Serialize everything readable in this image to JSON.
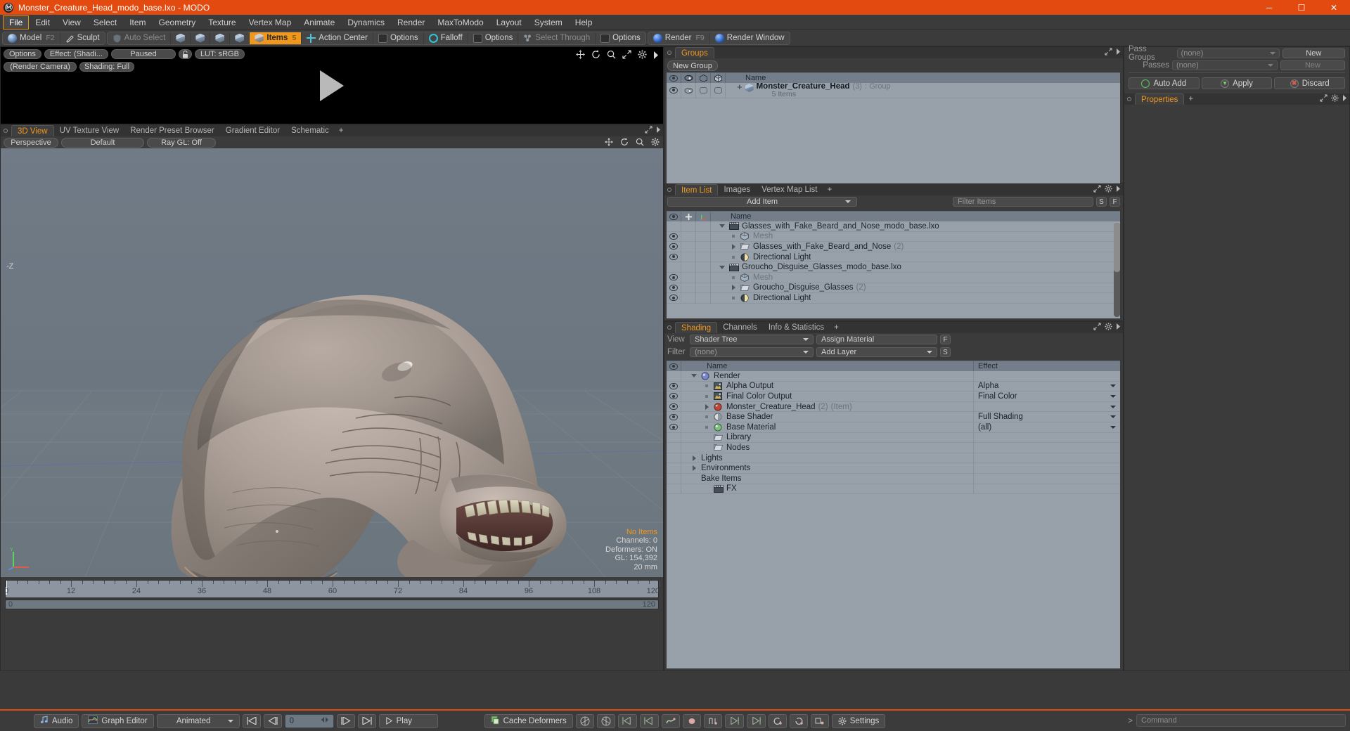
{
  "window": {
    "title": "Monster_Creature_Head_modo_base.lxo - MODO",
    "app_icon": "modo-logo-icon",
    "controls": {
      "minimize": "─",
      "maximize": "☐",
      "close": "✕"
    },
    "titlebar_color": "#e24a10"
  },
  "menubar": {
    "items": [
      "File",
      "Edit",
      "View",
      "Select",
      "Item",
      "Geometry",
      "Texture",
      "Vertex Map",
      "Animate",
      "Dynamics",
      "Render",
      "MaxToModo",
      "Layout",
      "System",
      "Help"
    ],
    "active": "File"
  },
  "toolbar": {
    "mode_group": [
      {
        "label": "Model",
        "key": "F2",
        "icon": "sphere-icon",
        "state": "normal"
      },
      {
        "label": "Sculpt",
        "key": "",
        "icon": "brush-icon",
        "state": "normal"
      }
    ],
    "select_group": [
      {
        "label": "Auto Select",
        "icon": "shield-icon",
        "state": "dim"
      },
      {
        "label": "",
        "icon": "vertex-mode-icon",
        "state": "normal"
      },
      {
        "label": "",
        "icon": "edge-mode-icon",
        "state": "normal"
      },
      {
        "label": "",
        "icon": "polygon-mode-icon",
        "state": "normal"
      },
      {
        "label": "",
        "icon": "material-mode-icon",
        "state": "normal"
      },
      {
        "label": "Items",
        "key": "5",
        "icon": "item-mode-icon",
        "state": "selected"
      },
      {
        "label": "Action Center",
        "icon": "action-center-icon",
        "state": "normal"
      },
      {
        "label": "Options",
        "icon": "options-icon",
        "state": "normal"
      },
      {
        "label": "Falloff",
        "icon": "falloff-icon",
        "state": "normal"
      },
      {
        "label": "Options",
        "icon": "options-icon",
        "state": "normal"
      },
      {
        "label": "Select Through",
        "icon": "select-through-icon",
        "state": "dim"
      },
      {
        "label": "Options",
        "icon": "options-icon",
        "state": "normal"
      }
    ],
    "render_group": [
      {
        "label": "Render",
        "key": "F9",
        "icon": "render-sphere-icon"
      },
      {
        "label": "Render Window",
        "key": "",
        "icon": "render-window-icon"
      }
    ]
  },
  "render_preview": {
    "buttons": [
      "Options",
      "Effect: (Shadi...",
      "Paused",
      "LUT: sRGB"
    ],
    "lock_icon": "lock-icon",
    "row2": [
      "(Render Camera)",
      "Shading: Full"
    ],
    "tool_icons": [
      "pan-icon",
      "rotate-icon",
      "zoom-icon",
      "fit-icon",
      "gear-icon",
      "chevron-right-icon"
    ],
    "center_glyph": "play-triangle-icon"
  },
  "viewport": {
    "tabs": [
      "3D View",
      "UV Texture View",
      "Render Preset Browser",
      "Gradient Editor",
      "Schematic"
    ],
    "active_tab": "3D View",
    "tab_plus": "+",
    "sub_buttons": [
      "Perspective",
      "Default",
      "Ray GL: Off"
    ],
    "tool_icons": [
      "pan-icon",
      "rotate-icon",
      "zoom-icon",
      "gear-icon"
    ],
    "stats": {
      "selection": "No Items",
      "channels": "Channels: 0",
      "deformers": "Deformers: ON",
      "gl": "GL: 154,392",
      "scale": "20 mm"
    },
    "axis_gizmo": {
      "y": "Y",
      "x": "X",
      "z": "Z"
    },
    "z_label": "-Z",
    "model_description": "Monster creature head 3D model, grey-tan textured, mouth open with teeth"
  },
  "timeline": {
    "ticks": [
      0,
      12,
      24,
      36,
      48,
      60,
      72,
      84,
      96,
      108,
      120
    ],
    "playhead_frame": 0,
    "range_start": "0",
    "range_end": "120",
    "total_label": "120"
  },
  "groups_panel": {
    "title": "Groups",
    "tool_icons": [
      "expand-icon",
      "chevron-right-icon"
    ],
    "new_group_button": "New Group",
    "columns": [
      "visible-eye-icon",
      "render-eye-icon",
      "wireframe-icon",
      "shaded-icon",
      "Name"
    ],
    "rows": [
      {
        "name": "Monster_Creature_Head",
        "count": "(3)",
        "type": ": Group",
        "sub": "5 Items",
        "icon": "group-cube-icon",
        "expander": "+"
      }
    ]
  },
  "item_list": {
    "tabs": [
      "Item List",
      "Images",
      "Vertex Map List"
    ],
    "active_tab": "Item List",
    "tab_plus": "+",
    "add_item_button": "Add Item",
    "filter_placeholder": "Filter Items",
    "filter_buttons": [
      "S",
      "F"
    ],
    "columns": [
      "visible-eye-icon",
      "lock-icon",
      "axis-icon",
      "Name"
    ],
    "rows": [
      {
        "indent": 0,
        "name": "Glasses_with_Fake_Beard_and_Nose_modo_base.lxo",
        "icon": "scene-clapper-icon",
        "expander": "down",
        "eye": false,
        "dim": false
      },
      {
        "indent": 1,
        "name": "Mesh",
        "icon": "mesh-cube-icon",
        "expander": "leaf",
        "eye": true,
        "dim": true
      },
      {
        "indent": 1,
        "name": "Glasses_with_Fake_Beard_and_Nose",
        "count": "(2)",
        "icon": "folder-icon",
        "expander": "right",
        "eye": true,
        "dim": false
      },
      {
        "indent": 1,
        "name": "Directional Light",
        "icon": "light-icon",
        "expander": "leaf",
        "eye": true,
        "dim": false
      },
      {
        "indent": 0,
        "name": "Groucho_Disguise_Glasses_modo_base.lxo",
        "icon": "scene-clapper-icon",
        "expander": "down",
        "eye": false,
        "dim": false
      },
      {
        "indent": 1,
        "name": "Mesh",
        "icon": "mesh-cube-icon",
        "expander": "leaf",
        "eye": true,
        "dim": true
      },
      {
        "indent": 1,
        "name": "Groucho_Disguise_Glasses",
        "count": "(2)",
        "icon": "folder-icon",
        "expander": "right",
        "eye": true,
        "dim": false
      },
      {
        "indent": 1,
        "name": "Directional Light",
        "icon": "light-icon",
        "expander": "leaf",
        "eye": true,
        "dim": false
      }
    ]
  },
  "shading_panel": {
    "tabs": [
      "Shading",
      "Channels",
      "Info & Statistics"
    ],
    "active_tab": "Shading",
    "tab_plus": "+",
    "view_label": "View",
    "view_value": "Shader Tree",
    "assign_material": "Assign Material",
    "assign_btn": "F",
    "filter_label": "Filter",
    "filter_value": "(none)",
    "add_layer": "Add Layer",
    "add_layer_btn": "S",
    "columns": [
      "visible-eye-icon",
      "Name",
      "Effect"
    ],
    "rows": [
      {
        "indent": 0,
        "name": "Render",
        "effect": "",
        "icon": "render-sphere-icon",
        "expander": "down",
        "eye": false
      },
      {
        "indent": 1,
        "name": "Alpha Output",
        "effect": "Alpha",
        "icon": "image-output-icon",
        "expander": "leaf",
        "eye": true
      },
      {
        "indent": 1,
        "name": "Final Color Output",
        "effect": "Final Color",
        "icon": "image-output-icon",
        "expander": "leaf",
        "eye": true
      },
      {
        "indent": 1,
        "name": "Monster_Creature_Head",
        "count": "(2)",
        "suffix": "(Item)",
        "effect": "",
        "icon": "material-red-icon",
        "expander": "right",
        "eye": true
      },
      {
        "indent": 1,
        "name": "Base Shader",
        "effect": "Full Shading",
        "icon": "shader-white-icon",
        "expander": "leaf",
        "eye": true
      },
      {
        "indent": 1,
        "name": "Base Material",
        "effect": "(all)",
        "icon": "material-green-icon",
        "expander": "leaf",
        "eye": true
      },
      {
        "indent": 1,
        "name": "Library",
        "effect": "",
        "icon": "folder-icon",
        "expander": "none",
        "eye": false
      },
      {
        "indent": 1,
        "name": "Nodes",
        "effect": "",
        "icon": "folder-icon",
        "expander": "none",
        "eye": false
      },
      {
        "indent": 0,
        "name": "Lights",
        "effect": "",
        "icon": "none",
        "expander": "right",
        "eye": false
      },
      {
        "indent": 0,
        "name": "Environments",
        "effect": "",
        "icon": "none",
        "expander": "right",
        "eye": false
      },
      {
        "indent": 0,
        "name": "Bake Items",
        "effect": "",
        "icon": "none",
        "expander": "none",
        "eye": false
      },
      {
        "indent": 1,
        "name": "FX",
        "effect": "",
        "icon": "scene-clapper-icon",
        "expander": "none",
        "eye": false
      }
    ]
  },
  "right_panel": {
    "pass_groups_label": "Pass Groups",
    "pass_groups_value": "(none)",
    "pass_groups_new": "New",
    "passes_label": "Passes",
    "passes_value": "(none)",
    "passes_new": "New",
    "auto_add": "Auto Add",
    "apply": "Apply",
    "discard": "Discard",
    "properties_tab": "Properties",
    "tab_plus": "+"
  },
  "bottom_bar": {
    "audio": "Audio",
    "graph_editor": "Graph Editor",
    "mode_select": "Animated",
    "frame_value": "0",
    "play": "Play",
    "cache_deformers": "Cache Deformers",
    "settings": "Settings",
    "transport_icons": [
      "go-start-icon",
      "step-back-icon",
      "step-forward-icon",
      "go-end-icon"
    ],
    "tool_icons": [
      "ik-icon",
      "fk-icon",
      "key-prev-icon",
      "key-first-icon",
      "curve-icon",
      "key-icon",
      "keys-icon",
      "key-next-icon",
      "key-last-icon",
      "reload-icon",
      "refresh-icon",
      "bake-icon"
    ],
    "command_placeholder": "Command",
    "command_prefix": ">"
  },
  "colors": {
    "accent_orange": "#f0971d",
    "title_orange": "#e24a10",
    "panel_bg": "#3b3b3b",
    "list_bg": "#98a0aa",
    "header_bg": "#737e8a"
  }
}
